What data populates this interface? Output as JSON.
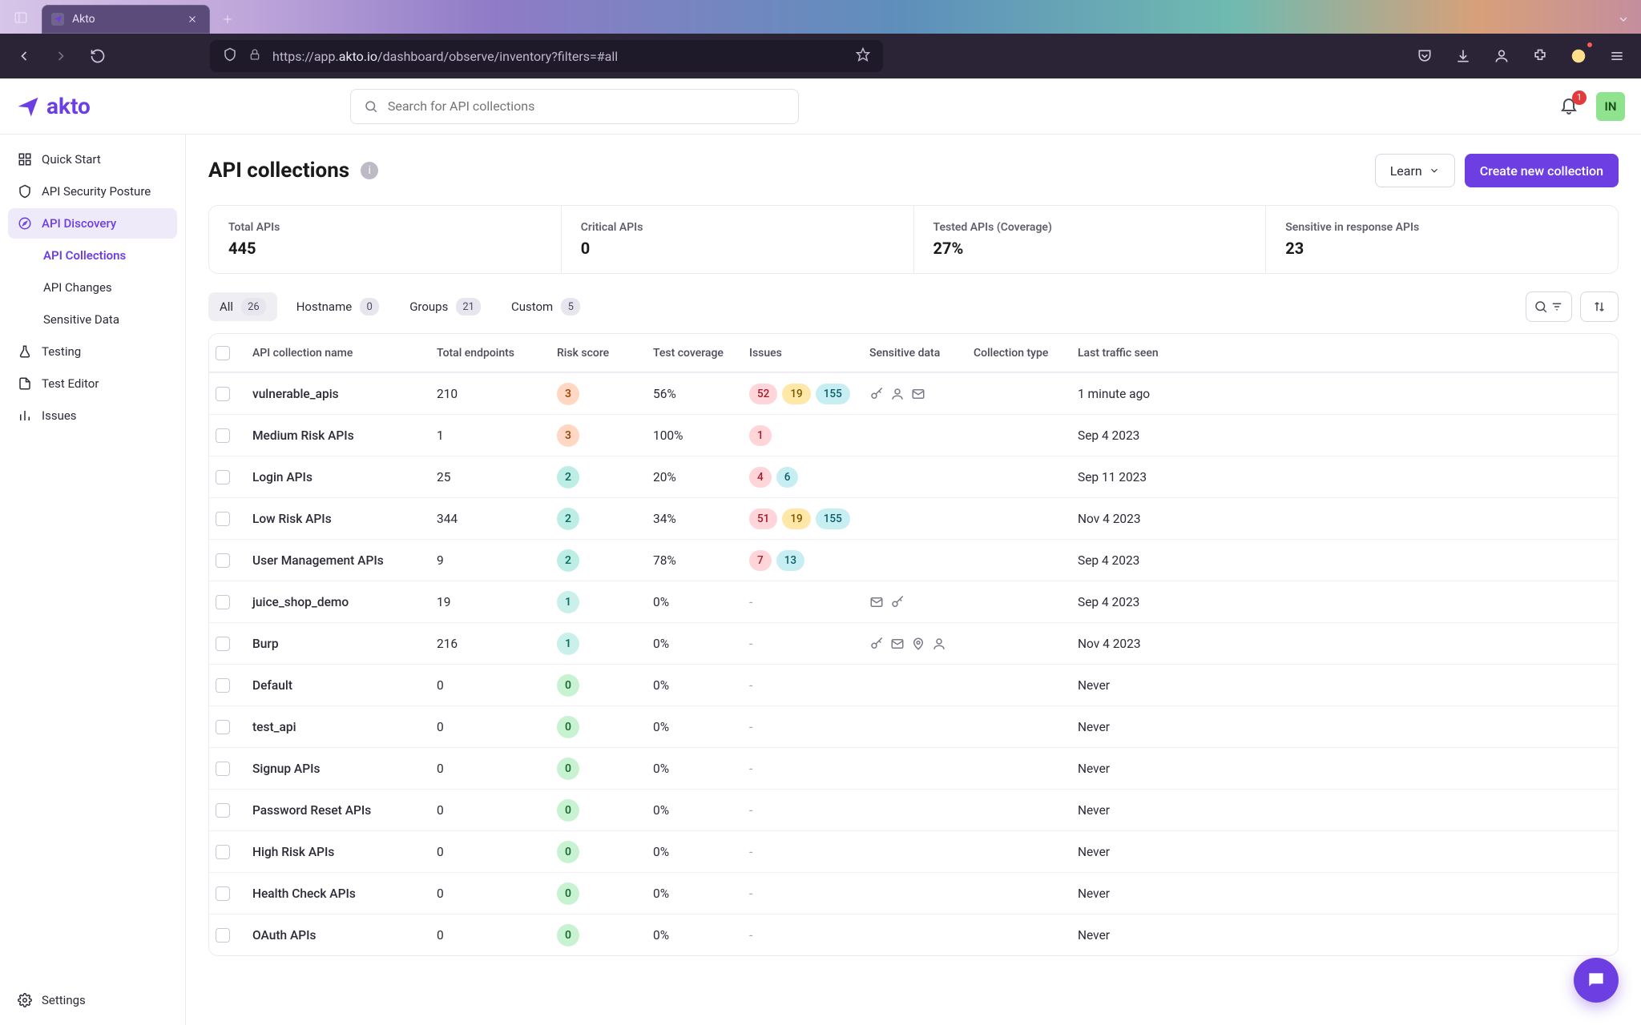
{
  "browser": {
    "tab_title": "Akto",
    "url_prefix": "https://app.",
    "url_bold": "akto.io",
    "url_suffix": "/dashboard/observe/inventory?filters=#all"
  },
  "app": {
    "brand": "akto",
    "search_placeholder": "Search for API collections",
    "bell_badge": "1",
    "avatar_initials": "IN"
  },
  "sidebar": {
    "items": [
      {
        "label": "Quick Start"
      },
      {
        "label": "API Security Posture"
      },
      {
        "label": "API Discovery"
      },
      {
        "label": "API Collections"
      },
      {
        "label": "API Changes"
      },
      {
        "label": "Sensitive Data"
      },
      {
        "label": "Testing"
      },
      {
        "label": "Test Editor"
      },
      {
        "label": "Issues"
      }
    ],
    "settings": "Settings"
  },
  "page": {
    "title": "API collections",
    "learn": "Learn",
    "create": "Create new collection"
  },
  "stats": [
    {
      "label": "Total APIs",
      "value": "445"
    },
    {
      "label": "Critical APIs",
      "value": "0"
    },
    {
      "label": "Tested APIs (Coverage)",
      "value": "27%"
    },
    {
      "label": "Sensitive in response APIs",
      "value": "23"
    }
  ],
  "tabs": [
    {
      "label": "All",
      "count": "26"
    },
    {
      "label": "Hostname",
      "count": "0"
    },
    {
      "label": "Groups",
      "count": "21"
    },
    {
      "label": "Custom",
      "count": "5"
    }
  ],
  "columns": {
    "c1": "API collection name",
    "c2": "Total endpoints",
    "c3": "Risk score",
    "c4": "Test coverage",
    "c5": "Issues",
    "c6": "Sensitive data",
    "c7": "Collection type",
    "c8": "Last traffic seen"
  },
  "rows": [
    {
      "name": "vulnerable_apis",
      "endpoints": "210",
      "risk": "3",
      "riskClass": "r3",
      "cov": "56%",
      "issues": [
        {
          "c": "red",
          "v": "52"
        },
        {
          "c": "amb",
          "v": "19"
        },
        {
          "c": "teal",
          "v": "155"
        }
      ],
      "sd": [
        "key",
        "user",
        "mail"
      ],
      "last": "1 minute ago"
    },
    {
      "name": "Medium Risk APIs",
      "endpoints": "1",
      "risk": "3",
      "riskClass": "r3",
      "cov": "100%",
      "issues": [
        {
          "c": "red",
          "v": "1"
        }
      ],
      "sd": [],
      "last": "Sep 4 2023"
    },
    {
      "name": "Login APIs",
      "endpoints": "25",
      "risk": "2",
      "riskClass": "r2",
      "cov": "20%",
      "issues": [
        {
          "c": "red",
          "v": "4"
        },
        {
          "c": "teal",
          "v": "6"
        }
      ],
      "sd": [],
      "last": "Sep 11 2023"
    },
    {
      "name": "Low Risk APIs",
      "endpoints": "344",
      "risk": "2",
      "riskClass": "r2",
      "cov": "34%",
      "issues": [
        {
          "c": "red",
          "v": "51"
        },
        {
          "c": "amb",
          "v": "19"
        },
        {
          "c": "teal",
          "v": "155"
        }
      ],
      "sd": [],
      "last": "Nov 4 2023"
    },
    {
      "name": "User Management APIs",
      "endpoints": "9",
      "risk": "2",
      "riskClass": "r2",
      "cov": "78%",
      "issues": [
        {
          "c": "red",
          "v": "7"
        },
        {
          "c": "teal",
          "v": "13"
        }
      ],
      "sd": [],
      "last": "Sep 4 2023"
    },
    {
      "name": "juice_shop_demo",
      "endpoints": "19",
      "risk": "1",
      "riskClass": "r1",
      "cov": "0%",
      "issues": "-",
      "sd": [
        "mail",
        "key"
      ],
      "last": "Sep 4 2023"
    },
    {
      "name": "Burp",
      "endpoints": "216",
      "risk": "1",
      "riskClass": "r1",
      "cov": "0%",
      "issues": "-",
      "sd": [
        "key",
        "mail",
        "pin",
        "user"
      ],
      "last": "Nov 4 2023"
    },
    {
      "name": "Default",
      "endpoints": "0",
      "risk": "0",
      "riskClass": "r0",
      "cov": "0%",
      "issues": "-",
      "sd": [],
      "last": "Never"
    },
    {
      "name": "test_api",
      "endpoints": "0",
      "risk": "0",
      "riskClass": "r0",
      "cov": "0%",
      "issues": "-",
      "sd": [],
      "last": "Never"
    },
    {
      "name": "Signup APIs",
      "endpoints": "0",
      "risk": "0",
      "riskClass": "r0",
      "cov": "0%",
      "issues": "-",
      "sd": [],
      "last": "Never"
    },
    {
      "name": "Password Reset APIs",
      "endpoints": "0",
      "risk": "0",
      "riskClass": "r0",
      "cov": "0%",
      "issues": "-",
      "sd": [],
      "last": "Never"
    },
    {
      "name": "High Risk APIs",
      "endpoints": "0",
      "risk": "0",
      "riskClass": "r0",
      "cov": "0%",
      "issues": "-",
      "sd": [],
      "last": "Never"
    },
    {
      "name": "Health Check APIs",
      "endpoints": "0",
      "risk": "0",
      "riskClass": "r0",
      "cov": "0%",
      "issues": "-",
      "sd": [],
      "last": "Never"
    },
    {
      "name": "OAuth APIs",
      "endpoints": "0",
      "risk": "0",
      "riskClass": "r0",
      "cov": "0%",
      "issues": "-",
      "sd": [],
      "last": "Never"
    }
  ]
}
